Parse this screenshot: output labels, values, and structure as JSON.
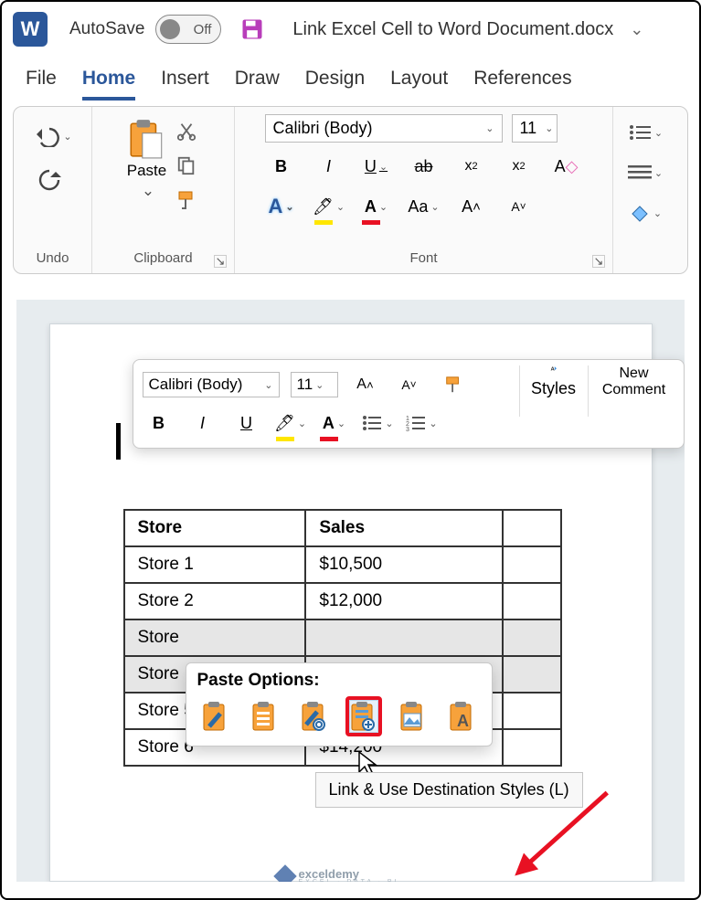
{
  "title_bar": {
    "autosave_label": "AutoSave",
    "autosave_state": "Off",
    "doc_title": "Link Excel Cell to Word Document.docx"
  },
  "tabs": {
    "file": "File",
    "home": "Home",
    "insert": "Insert",
    "draw": "Draw",
    "design": "Design",
    "layout": "Layout",
    "references": "References"
  },
  "ribbon": {
    "undo_label": "Undo",
    "clipboard_label": "Clipboard",
    "paste_label": "Paste",
    "font_label": "Font",
    "font_name": "Calibri (Body)",
    "font_size": "11",
    "aa_label": "Aa"
  },
  "mini": {
    "font_name": "Calibri (Body)",
    "font_size": "11",
    "styles": "Styles",
    "new_comment_l1": "New",
    "new_comment_l2": "Comment"
  },
  "table": {
    "headers": {
      "c1": "Store",
      "c2": "Sales"
    },
    "rows": [
      {
        "c1": "Store 1",
        "c2": "$10,500"
      },
      {
        "c1": "Store 2",
        "c2": "$12,000"
      },
      {
        "c1": "Store",
        "c2": ""
      },
      {
        "c1": "Store",
        "c2": ""
      },
      {
        "c1": "Store 5",
        "c2": ""
      },
      {
        "c1": "Store 6",
        "c2": "$14,200"
      }
    ]
  },
  "paste_options": {
    "title": "Paste Options:",
    "tooltip": "Link & Use Destination Styles (L)"
  },
  "watermark": {
    "brand": "exceldemy",
    "tag": "EXCEL · DATA · BI"
  }
}
